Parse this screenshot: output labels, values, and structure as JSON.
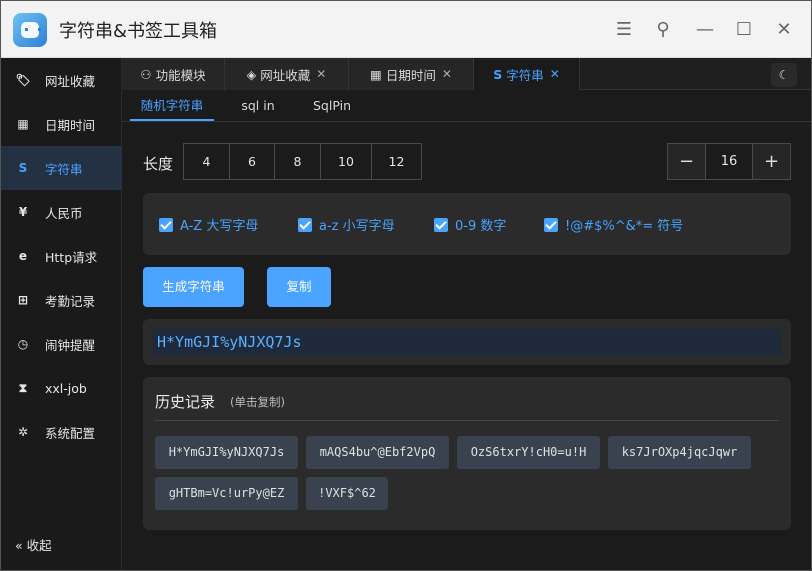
{
  "window": {
    "title": "字符串&书签工具箱"
  },
  "sidebar": {
    "items": [
      {
        "label": "网址收藏",
        "icon": "tag-icon",
        "glyph": "🏷"
      },
      {
        "label": "日期时间",
        "icon": "calendar-icon",
        "glyph": "▦"
      },
      {
        "label": "字符串",
        "icon": "string-s-icon",
        "glyph": "S"
      },
      {
        "label": "人民币",
        "icon": "yuan-icon",
        "glyph": "¥"
      },
      {
        "label": "Http请求",
        "icon": "browser-e-icon",
        "glyph": "e"
      },
      {
        "label": "考勤记录",
        "icon": "grid-icon",
        "glyph": "⊞"
      },
      {
        "label": "闹钟提醒",
        "icon": "clock-icon",
        "glyph": "◷"
      },
      {
        "label": "xxl-job",
        "icon": "hourglass-icon",
        "glyph": "⧗"
      },
      {
        "label": "系统配置",
        "icon": "gear-icon",
        "glyph": "✲"
      }
    ],
    "collapse_label": "« 收起"
  },
  "tabs": [
    {
      "label": "功能模块",
      "icon": "users-icon",
      "glyph": "⚇",
      "closable": false
    },
    {
      "label": "网址收藏",
      "icon": "tag-icon",
      "glyph": "◈",
      "closable": true
    },
    {
      "label": "日期时间",
      "icon": "calendar-icon",
      "glyph": "▦",
      "closable": true
    },
    {
      "label": "字符串",
      "icon": "string-s-icon",
      "glyph": "S",
      "closable": true
    }
  ],
  "close_glyph": "✕",
  "theme_glyph": "☾",
  "subtabs": [
    "随机字符串",
    "sql in",
    "SqlPin"
  ],
  "length": {
    "label": "长度",
    "presets": [
      "4",
      "6",
      "8",
      "10",
      "12"
    ],
    "value": "16",
    "minus": "−",
    "plus": "+"
  },
  "options": [
    "A-Z 大写字母",
    "a-z 小写字母",
    "0-9 数字",
    "!@#$%^&*= 符号"
  ],
  "buttons": {
    "generate": "生成字符串",
    "copy": "复制"
  },
  "result": "H*YmGJI%yNJXQ7Js",
  "history": {
    "title": "历史记录",
    "subtitle": "(单击复制)",
    "items": [
      "H*YmGJI%yNJXQ7Js",
      "mAQS4bu^@Ebf2VpQ",
      "OzS6txrY!cH0=u!H",
      "ks7JrOXp4jqcJqwr",
      "gHTBm=Vc!urPy@EZ",
      "!VXF$^62"
    ]
  },
  "colors": {
    "accent": "#47a3ff",
    "bg": "#1b1b1b",
    "panel": "#2b2b2b"
  }
}
